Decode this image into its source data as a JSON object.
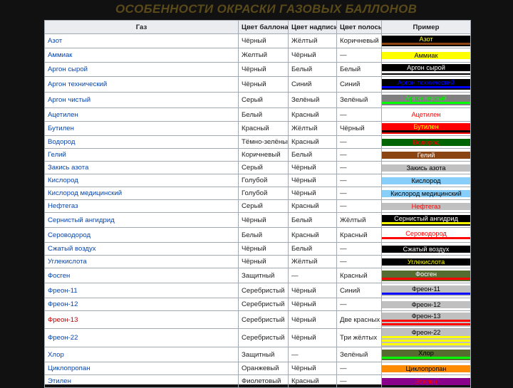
{
  "slide_title": "ОСОБЕННОСТИ ОКРАСКИ ГАЗОВЫХ БАЛЛОНОВ",
  "table": {
    "headers": [
      "Газ",
      "Цвет баллона",
      "Цвет надписи",
      "Цвет полосы",
      "Пример"
    ],
    "rows": [
      {
        "gas": "Азот",
        "body": "Чёрный",
        "text": "Жёлтый",
        "stripe": "Коричневый",
        "example": "Азот",
        "bg": "#000000",
        "fg": "#ffff00",
        "stripes": [
          "#8b4513"
        ],
        "h": 20
      },
      {
        "gas": "Аммиак",
        "body": "Желтый",
        "text": "Чёрный",
        "stripe": "—",
        "example": "Аммиак",
        "bg": "#ffff00",
        "fg": "#000000",
        "stripes": [],
        "h": 20
      },
      {
        "gas": "Аргон сырой",
        "body": "Чёрный",
        "text": "Белый",
        "stripe": "Белый",
        "example": "Аргон сырой",
        "bg": "#000000",
        "fg": "#ffffff",
        "stripes": [
          "#ffffff"
        ],
        "h": 20
      },
      {
        "gas": "Аргон технический",
        "body": "Чёрный",
        "text": "Синий",
        "stripe": "Синий",
        "example": "Аргон технический",
        "bg": "#000000",
        "fg": "#0000ff",
        "stripes": [
          "#0000ff"
        ],
        "h": 22
      },
      {
        "gas": "Аргон чистый",
        "body": "Серый",
        "text": "Зелёный",
        "stripe": "Зелёный",
        "example": "Аргон чистый",
        "bg": "#808080",
        "fg": "#00ff00",
        "stripes": [
          "#00ff00"
        ],
        "h": 22
      },
      {
        "gas": "Ацетилен",
        "body": "Белый",
        "text": "Красный",
        "stripe": "—",
        "example": "Ацетилен",
        "bg": "#ffffff",
        "fg": "#ff0000",
        "stripes": [],
        "h": 19
      },
      {
        "gas": "Бутилен",
        "body": "Красный",
        "text": "Жёлтый",
        "stripe": "Чёрный",
        "example": "Бутилен",
        "bg": "#ff0000",
        "fg": "#ffff00",
        "stripes": [
          "#000000"
        ],
        "h": 20
      },
      {
        "gas": "Водород",
        "body": "Тёмно-зелёный",
        "text": "Красный",
        "stripe": "—",
        "example": "Водород",
        "bg": "#006400",
        "fg": "#ff0000",
        "stripes": [],
        "h": 18
      },
      {
        "gas": "Гелий",
        "body": "Коричневый",
        "text": "Белый",
        "stripe": "—",
        "example": "Гелий",
        "bg": "#8b4513",
        "fg": "#ffffff",
        "stripes": [],
        "h": 18
      },
      {
        "gas": "Закись азота",
        "body": "Серый",
        "text": "Чёрный",
        "stripe": "—",
        "example": "Закись азота",
        "bg": "#c0c0c0",
        "fg": "#000000",
        "stripes": [],
        "h": 18
      },
      {
        "gas": "Кислород",
        "body": "Голубой",
        "text": "Чёрный",
        "stripe": "—",
        "example": "Кислород",
        "bg": "#87cefa",
        "fg": "#000000",
        "stripes": [],
        "h": 18
      },
      {
        "gas": "Кислород медицинский",
        "body": "Голубой",
        "text": "Чёрный",
        "stripe": "—",
        "example": "Кислород медицинский",
        "bg": "#87cefa",
        "fg": "#000000",
        "stripes": [],
        "h": 18
      },
      {
        "gas": "Нефтегаз",
        "body": "Серый",
        "text": "Красный",
        "stripe": "—",
        "example": "Нефтегаз",
        "bg": "#c0c0c0",
        "fg": "#ff0000",
        "stripes": [],
        "h": 18
      },
      {
        "gas": "Сернистый ангидрид",
        "body": "Чёрный",
        "text": "Белый",
        "stripe": "Жёлтый",
        "example": "Сернистый ангидрид",
        "bg": "#000000",
        "fg": "#ffffff",
        "stripes": [
          "#ffff00"
        ],
        "h": 21
      },
      {
        "gas": "Сероводород",
        "body": "Белый",
        "text": "Красный",
        "stripe": "Красный",
        "example": "Сероводород",
        "bg": "#ffffff",
        "fg": "#ff0000",
        "stripes": [
          "#ff0000"
        ],
        "h": 21
      },
      {
        "gas": "Сжатый воздух",
        "body": "Чёрный",
        "text": "Белый",
        "stripe": "—",
        "example": "Сжатый воздух",
        "bg": "#000000",
        "fg": "#ffffff",
        "stripes": [],
        "h": 18
      },
      {
        "gas": "Углекислота",
        "body": "Чёрный",
        "text": "Жёлтый",
        "stripe": "—",
        "example": "Углекислота",
        "bg": "#000000",
        "fg": "#ffff00",
        "stripes": [],
        "h": 18
      },
      {
        "gas": "Фосген",
        "body": "Защитный",
        "text": "—",
        "stripe": "Красный",
        "example": "Фосген",
        "bg": "#556b2f",
        "fg": "#ffffff",
        "stripes": [
          "#ff0000"
        ],
        "h": 21
      },
      {
        "gas": "Фреон-11",
        "body": "Серебристый",
        "text": "Чёрный",
        "stripe": "Синий",
        "example": "Фреон-11",
        "bg": "#c0c0c0",
        "fg": "#000000",
        "stripes": [
          "#0000ff"
        ],
        "h": 21
      },
      {
        "gas": "Фреон-12",
        "body": "Серебристый",
        "text": "Чёрный",
        "stripe": "—",
        "example": "Фреон-12",
        "bg": "#c0c0c0",
        "fg": "#000000",
        "stripes": [],
        "h": 18
      },
      {
        "gas": "Фреон-13",
        "body": "Серебристый",
        "text": "Чёрный",
        "stripe": "Две красных",
        "example": "Фреон-13",
        "bg": "#c0c0c0",
        "fg": "#000000",
        "stripes": [
          "#ff0000",
          "#ff0000"
        ],
        "h": 25,
        "red": true
      },
      {
        "gas": "Фреон-22",
        "body": "Серебристый",
        "text": "Чёрный",
        "stripe": "Три жёлтых",
        "example": "Фреон-22",
        "bg": "#c0c0c0",
        "fg": "#000000",
        "stripes": [
          "#ffff00",
          "#ffff00",
          "#ffff00"
        ],
        "h": 26
      },
      {
        "gas": "Хлор",
        "body": "Защитный",
        "text": "—",
        "stripe": "Зелёный",
        "example": "Хлор",
        "bg": "#556b2f",
        "fg": "#000000",
        "stripes": [
          "#00ff00"
        ],
        "h": 21
      },
      {
        "gas": "Циклопропан",
        "body": "Оранжевый",
        "text": "Чёрный",
        "stripe": "—",
        "example": "Циклопропан",
        "bg": "#ff8c00",
        "fg": "#000000",
        "stripes": [],
        "h": 18
      },
      {
        "gas": "Этилен",
        "body": "Фиолетовый",
        "text": "Красный",
        "stripe": "—",
        "example": "Этилен",
        "bg": "#8b008b",
        "fg": "#ff0000",
        "stripes": [],
        "h": 18
      }
    ]
  }
}
